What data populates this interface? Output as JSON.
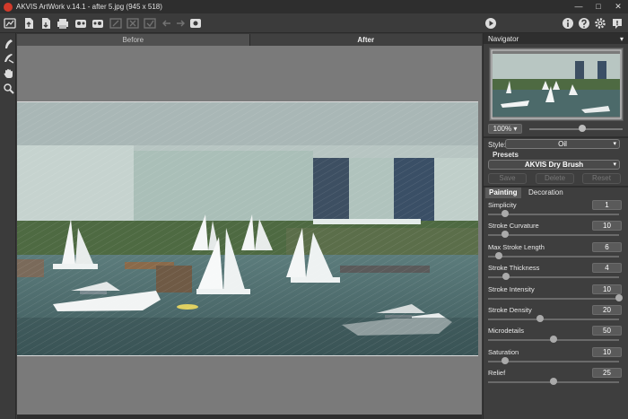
{
  "window": {
    "title": "AKVIS ArtWork v.14.1 - after 5.jpg (945 x 518)",
    "buttons": [
      "minimize",
      "maximize",
      "close"
    ]
  },
  "toolbar": {
    "left_icons": [
      "home-icon",
      "open-icon",
      "save-icon",
      "print-icon",
      "import-strokes-icon",
      "export-strokes-icon",
      "batch-icon",
      "undo-all-icon",
      "redo-all-icon",
      "undo-icon",
      "redo-icon",
      "plugins-icon"
    ],
    "right_icons": [
      "run-icon",
      "info-icon",
      "help-icon",
      "settings-icon",
      "tips-icon"
    ]
  },
  "tools": [
    "direction-tool-icon",
    "strokes-tool-icon",
    "hand-icon",
    "zoom-icon"
  ],
  "view_tabs": {
    "before": "Before",
    "after": "After"
  },
  "navigator": {
    "title": "Navigator",
    "zoom": "100%",
    "zoom_level_fraction": 0.95
  },
  "settings": {
    "style_label": "Style:",
    "style_value": "Oil",
    "presets_label": "Presets",
    "preset_value": "AKVIS Dry Brush",
    "save_label": "Save",
    "delete_label": "Delete",
    "reset_label": "Reset",
    "tab_painting": "Painting",
    "tab_decoration": "Decoration"
  },
  "params": [
    {
      "label": "Simplicity",
      "value": "1",
      "fraction": 0.13
    },
    {
      "label": "Stroke Curvature",
      "value": "10",
      "fraction": 0.13
    },
    {
      "label": "Max Stroke Length",
      "value": "6",
      "fraction": 0.08
    },
    {
      "label": "Stroke Thickness",
      "value": "4",
      "fraction": 0.14
    },
    {
      "label": "Stroke Intensity",
      "value": "10",
      "fraction": 1.0
    },
    {
      "label": "Stroke Density",
      "value": "20",
      "fraction": 0.4
    },
    {
      "label": "Microdetails",
      "value": "50",
      "fraction": 0.5
    },
    {
      "label": "Saturation",
      "value": "10",
      "fraction": 0.13
    },
    {
      "label": "Relief",
      "value": "25",
      "fraction": 0.5
    }
  ]
}
